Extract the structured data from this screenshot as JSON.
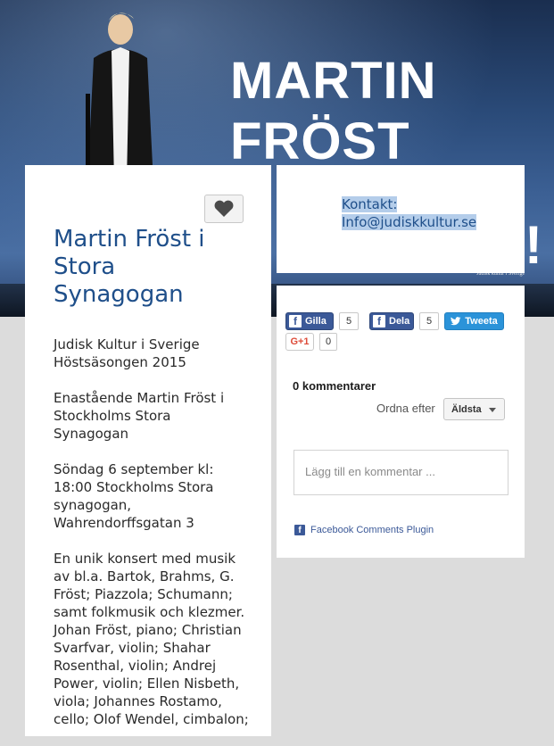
{
  "hero": {
    "title_line1": "MARTIN",
    "title_line2": "FRÖST",
    "exclamation": "!",
    "credit_line1": "Judisk kultur i Sverige"
  },
  "event": {
    "title": "Martin Fröst i Stora Synagogan",
    "paragraphs": [
      "Judisk Kultur i Sverige Höstsäsongen 2015",
      "Enastående Martin Fröst i Stockholms Stora Synagogan",
      "Söndag 6 september kl: 18:00 Stockholms Stora synagogan, Wahrendorffsgatan 3",
      "En unik konsert med musik av bl.a. Bartok, Brahms, G. Fröst; Piazzola; Schumann; samt folkmusik och klezmer. Johan Fröst, piano; Christian Svarfvar, violin; Shahar Rosenthal, violin; Andrej Power, violin; Ellen Nisbeth, viola; Johannes Rostamo, cello; Olof Wendel, cimbalon;"
    ]
  },
  "contact": {
    "label": "Kontakt:",
    "email": "Info@judiskkultur.se"
  },
  "social": {
    "gilla_label": "Gilla",
    "gilla_count": "5",
    "dela_label": "Dela",
    "dela_count": "5",
    "tweet_label": "Tweeta",
    "gplus_label": "G+1",
    "gplus_count": "0"
  },
  "comments": {
    "count_label": "0 kommentarer",
    "sort_label": "Ordna efter",
    "sort_value": "Äldsta",
    "input_placeholder": "Lägg till en kommentar ...",
    "plugin_label": "Facebook Comments Plugin"
  },
  "colors": {
    "title_blue": "#1f4f8a",
    "facebook_blue": "#3b5998",
    "twitter_blue": "#2b93d9",
    "selection_highlight": "#b4cdea"
  }
}
